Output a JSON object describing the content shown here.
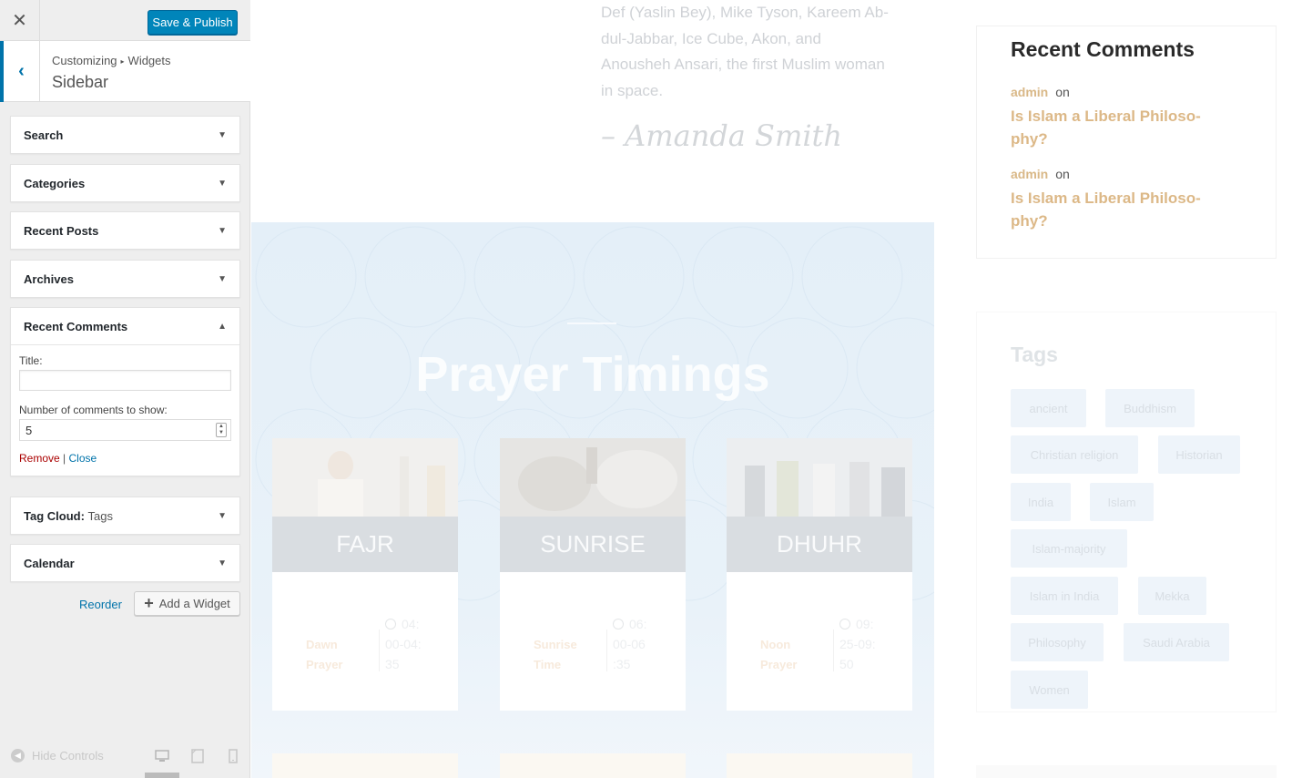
{
  "customizer": {
    "close_icon": "close-icon",
    "save_label": "Save & Publish",
    "breadcrumb_root": "Customizing",
    "breadcrumb_child": "Widgets",
    "section_title": "Sidebar",
    "widgets": [
      {
        "title": "Search",
        "expanded": false
      },
      {
        "title": "Categories",
        "expanded": false
      },
      {
        "title": "Recent Posts",
        "expanded": false
      },
      {
        "title": "Archives",
        "expanded": false
      },
      {
        "title": "Recent Comments",
        "expanded": true
      },
      {
        "title": "Tag Cloud:",
        "subtitle": "Tags",
        "expanded": false
      },
      {
        "title": "Calendar",
        "expanded": false
      }
    ],
    "recent_comments_form": {
      "title_label": "Title:",
      "title_value": "",
      "number_label": "Number of comments to show:",
      "number_value": "5",
      "remove_label": "Remove",
      "separator": "|",
      "close_label": "Close"
    },
    "reorder_label": "Reorder",
    "add_widget_label": "Add a Widget",
    "hide_controls_label": "Hide Controls",
    "accent_color": "#0085ba"
  },
  "preview": {
    "quote_lines": [
      "Def (Yaslin Bey), Mike Tyson, Kareem Ab-",
      "dul-Jabbar, Ice Cube, Akon, and",
      "Anousheh Ansari, the first Muslim woman",
      "in space."
    ],
    "quote_author": "– Amanda Smith",
    "prayer_title": "Prayer Timings",
    "prayer_cards": [
      {
        "name": "FAJR",
        "label_line1": "Dawn",
        "label_line2": "Prayer",
        "time_line1": "04:",
        "time_line2": "00-04:",
        "time_line3": "35"
      },
      {
        "name": "SUNRISE",
        "label_line1": "Sunrise",
        "label_line2": "Time",
        "time_line1": "06:",
        "time_line2": "00-06",
        "time_line3": ":35"
      },
      {
        "name": "DHUHR",
        "label_line1": "Noon",
        "label_line2": "Prayer",
        "time_line1": "09:",
        "time_line2": "25-09:",
        "time_line3": "50"
      }
    ],
    "recent_comments": {
      "heading": "Recent Comments",
      "items": [
        {
          "author": "admin",
          "on": "on",
          "link_line1": "Is Islam a Liberal Philoso-",
          "link_line2": "phy?"
        },
        {
          "author": "admin",
          "on": "on",
          "link_line1": "Is Islam a Liberal Philoso-",
          "link_line2": "phy?"
        }
      ]
    },
    "tags": {
      "heading": "Tags",
      "items": [
        "ancient",
        "Buddhism",
        "Christian religion",
        "Historian",
        "India",
        "Islam",
        "Islam-majority",
        "Islam in India",
        "Mekka",
        "Philosophy",
        "Saudi Arabia",
        "Women"
      ]
    },
    "link_color": "#dcb887"
  }
}
